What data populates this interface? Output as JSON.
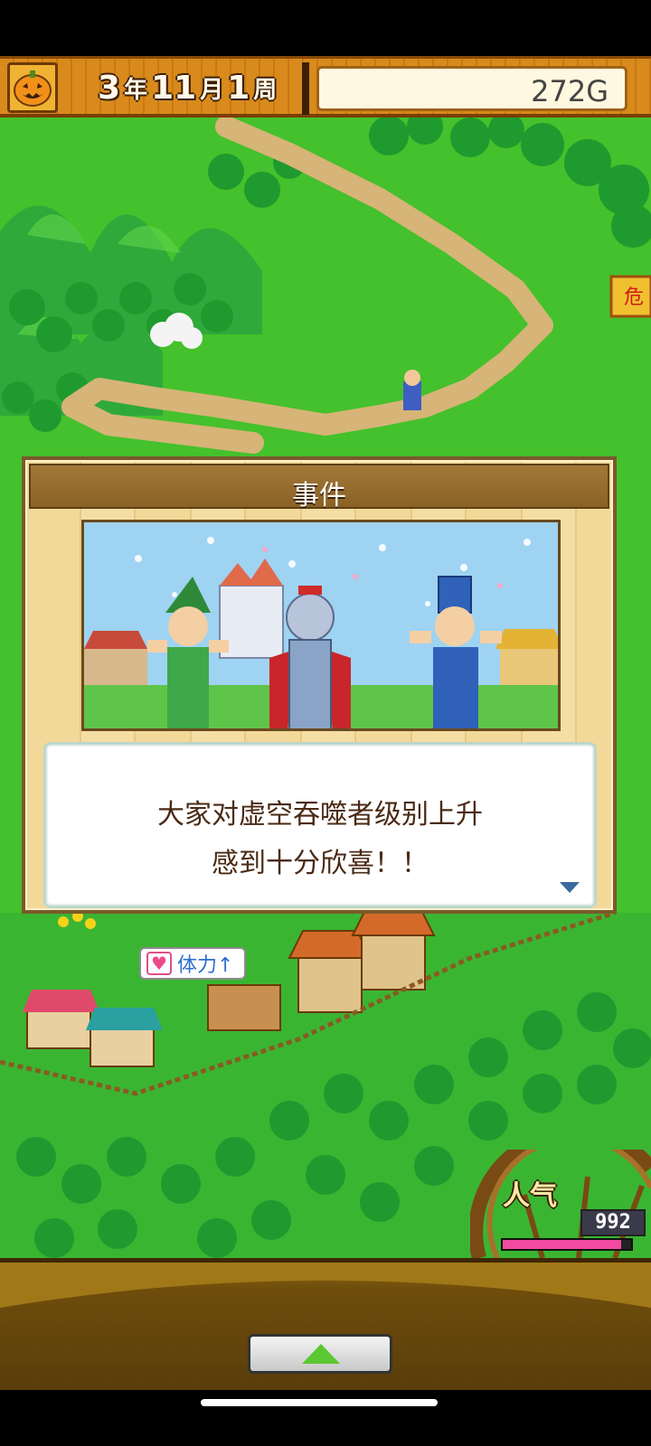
{
  "hud": {
    "year": "3",
    "year_unit": "年",
    "month": "11",
    "month_unit": "月",
    "week": "1",
    "week_unit": "周",
    "gold": "272G"
  },
  "map_sign": "危",
  "stamina_bubble": {
    "heart_icon": "♥",
    "label": "体力↑"
  },
  "popularity": {
    "label": "人气",
    "value": "992",
    "level": 0.92
  },
  "event_dialog": {
    "title": "事件",
    "message_line1": "大家对虚空吞噬者级别上升",
    "message_line2": "感到十分欣喜！！",
    "picture": "three-heroes-cheering-before-castle"
  },
  "colors": {
    "hud_orange": "#d98a1c",
    "grass": "#44c12c",
    "forest": "#1f9a2e",
    "path": "#d7b477",
    "popularity_pink": "#f04ba0",
    "menu_arrow": "#5ac832"
  },
  "icons": {
    "pumpkin": "pumpkin-icon",
    "menu_toggle": "up-triangle-icon",
    "dialog_next": "down-triangle-icon"
  }
}
